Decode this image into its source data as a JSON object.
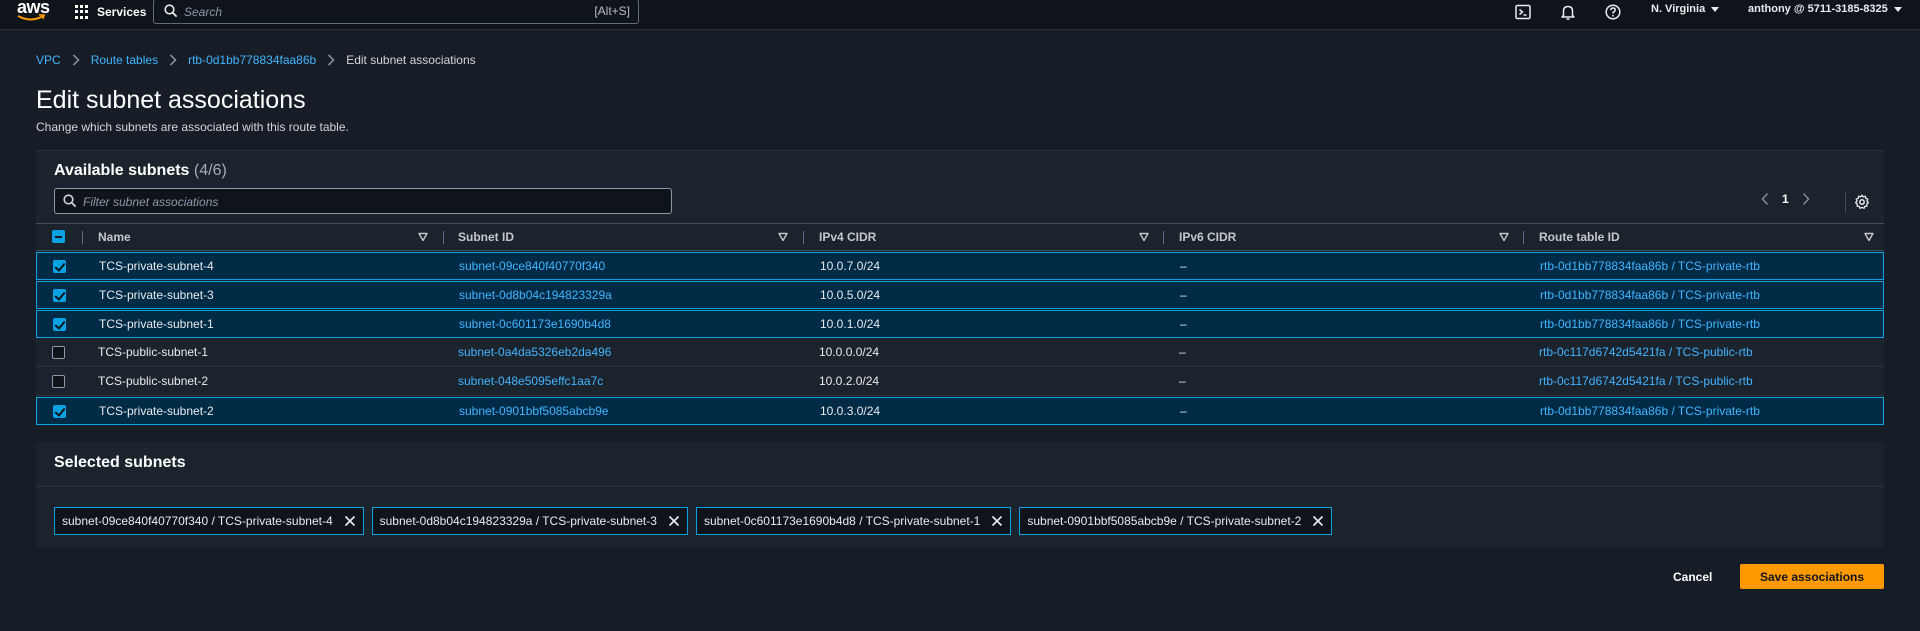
{
  "topnav": {
    "logo_text": "aws",
    "services_label": "Services",
    "search_placeholder": "Search",
    "search_shortcut": "[Alt+S]",
    "region": "N. Virginia",
    "account": "anthony @ 5711-3185-8325"
  },
  "breadcrumb": {
    "items": [
      "VPC",
      "Route tables",
      "rtb-0d1bb778834faa86b"
    ],
    "current": "Edit subnet associations"
  },
  "page": {
    "title": "Edit subnet associations",
    "description": "Change which subnets are associated with this route table."
  },
  "available": {
    "title": "Available subnets",
    "count": "(4/6)",
    "filter_placeholder": "Filter subnet associations",
    "page": "1",
    "columns": [
      "Name",
      "Subnet ID",
      "IPv4 CIDR",
      "IPv6 CIDR",
      "Route table ID"
    ],
    "rows": [
      {
        "checked": true,
        "name": "TCS-private-subnet-4",
        "subnet_id": "subnet-09ce840f40770f340",
        "ipv4": "10.0.7.0/24",
        "ipv6": "–",
        "route_table": "rtb-0d1bb778834faa86b / TCS-private-rtb"
      },
      {
        "checked": true,
        "name": "TCS-private-subnet-3",
        "subnet_id": "subnet-0d8b04c194823329a",
        "ipv4": "10.0.5.0/24",
        "ipv6": "–",
        "route_table": "rtb-0d1bb778834faa86b / TCS-private-rtb"
      },
      {
        "checked": true,
        "name": "TCS-private-subnet-1",
        "subnet_id": "subnet-0c601173e1690b4d8",
        "ipv4": "10.0.1.0/24",
        "ipv6": "–",
        "route_table": "rtb-0d1bb778834faa86b / TCS-private-rtb"
      },
      {
        "checked": false,
        "name": "TCS-public-subnet-1",
        "subnet_id": "subnet-0a4da5326eb2da496",
        "ipv4": "10.0.0.0/24",
        "ipv6": "–",
        "route_table": "rtb-0c117d6742d5421fa / TCS-public-rtb"
      },
      {
        "checked": false,
        "name": "TCS-public-subnet-2",
        "subnet_id": "subnet-048e5095effc1aa7c",
        "ipv4": "10.0.2.0/24",
        "ipv6": "–",
        "route_table": "rtb-0c117d6742d5421fa / TCS-public-rtb"
      },
      {
        "checked": true,
        "name": "TCS-private-subnet-2",
        "subnet_id": "subnet-0901bbf5085abcb9e",
        "ipv4": "10.0.3.0/24",
        "ipv6": "–",
        "route_table": "rtb-0d1bb778834faa86b / TCS-private-rtb"
      }
    ]
  },
  "selected": {
    "title": "Selected subnets",
    "tokens": [
      "subnet-09ce840f40770f340 / TCS-private-subnet-4",
      "subnet-0d8b04c194823329a / TCS-private-subnet-3",
      "subnet-0c601173e1690b4d8 / TCS-private-subnet-1",
      "subnet-0901bbf5085abcb9e / TCS-private-subnet-2"
    ]
  },
  "actions": {
    "cancel": "Cancel",
    "save": "Save associations"
  },
  "colors": {
    "background": "#161d26",
    "panel": "#1b232d",
    "link": "#42b4ff",
    "selection_border": "#0aa2e3",
    "primary_button": "#ff9900"
  }
}
